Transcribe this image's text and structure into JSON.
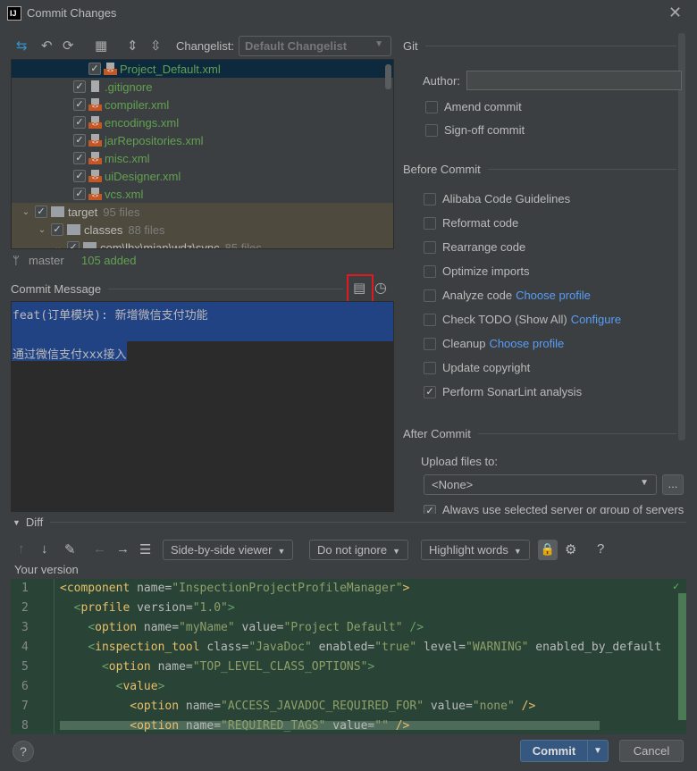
{
  "window": {
    "title": "Commit Changes",
    "logo": "IJ"
  },
  "toolbar": {
    "changelist_label": "Changelist:",
    "changelist_value": "Default Changelist"
  },
  "tree": [
    {
      "name": "Project_Default.xml",
      "type": "xml",
      "selected": true
    },
    {
      "name": ".gitignore",
      "type": "ignore"
    },
    {
      "name": "compiler.xml",
      "type": "xml"
    },
    {
      "name": "encodings.xml",
      "type": "xml"
    },
    {
      "name": "jarRepositories.xml",
      "type": "xml"
    },
    {
      "name": "misc.xml",
      "type": "xml"
    },
    {
      "name": "uiDesigner.xml",
      "type": "xml"
    },
    {
      "name": "vcs.xml",
      "type": "xml"
    },
    {
      "name": "target",
      "count": "95 files",
      "type": "dir"
    },
    {
      "name": "classes",
      "count": "88 files",
      "type": "dir"
    },
    {
      "name": "com\\lbx\\mian\\wdz\\sync",
      "count": "85 files",
      "type": "dir"
    }
  ],
  "status": {
    "branch": "master",
    "added": "105 added"
  },
  "commit_message": {
    "label": "Commit Message",
    "line1": "feat(订单模块): 新增微信支付功能",
    "line3": "通过微信支付xxx接入"
  },
  "git": {
    "section": "Git",
    "author_label": "Author:",
    "author_value": "",
    "amend": "Amend commit",
    "signoff": "Sign-off commit"
  },
  "before_commit": {
    "section": "Before Commit",
    "items": [
      {
        "label": "Alibaba Code Guidelines",
        "checked": false
      },
      {
        "label": "Reformat code",
        "checked": false
      },
      {
        "label": "Rearrange code",
        "checked": false
      },
      {
        "label": "Optimize imports",
        "checked": false
      },
      {
        "label": "Analyze code",
        "link": "Choose profile",
        "checked": false
      },
      {
        "label": "Check TODO (Show All)",
        "link": "Configure",
        "checked": false
      },
      {
        "label": "Cleanup",
        "link": "Choose profile",
        "checked": false
      },
      {
        "label": "Update copyright",
        "checked": false
      },
      {
        "label": "Perform SonarLint analysis",
        "checked": true
      }
    ]
  },
  "after_commit": {
    "section": "After Commit",
    "upload_label": "Upload files to:",
    "upload_value": "<None>",
    "dots": "...",
    "always": "Always use selected server or group of servers"
  },
  "diff": {
    "section": "Diff",
    "viewer": "Side-by-side viewer",
    "ignore": "Do not ignore",
    "highlight": "Highlight words",
    "help": "?",
    "your_version": "Your version",
    "lines": [
      {
        "n": "1",
        "html": "<span class='t'>&lt;component</span> name=<span class='v'>\"InspectionProjectProfileManager\"</span><span class='t'>&gt;</span>"
      },
      {
        "n": "2",
        "html": "  <span class='p'>&lt;</span><span class='t'>profile</span> version=<span class='v'>\"1.0\"</span><span class='p'>&gt;</span>"
      },
      {
        "n": "3",
        "html": "    <span class='p'>&lt;</span><span class='t'>option</span> name=<span class='v'>\"myName\"</span> value=<span class='v'>\"Project Default\"</span> <span class='p'>/&gt;</span>"
      },
      {
        "n": "4",
        "html": "    <span class='p'>&lt;</span><span class='t'>inspection_tool</span> class=<span class='v'>\"JavaDoc\"</span> enabled=<span class='v'>\"true\"</span> level=<span class='v'>\"WARNING\"</span> enabled_by_default"
      },
      {
        "n": "5",
        "html": "      <span class='p'>&lt;</span><span class='t'>option</span> name=<span class='v'>\"TOP_LEVEL_CLASS_OPTIONS\"</span><span class='p'>&gt;</span>"
      },
      {
        "n": "6",
        "html": "        <span class='p'>&lt;</span><span class='t'>value</span><span class='p'>&gt;</span>"
      },
      {
        "n": "7",
        "html": "          <span class='t'>&lt;option</span> name=<span class='v'>\"ACCESS_JAVADOC_REQUIRED_FOR\"</span> value=<span class='v'>\"none\"</span> <span class='t'>/&gt;</span>"
      },
      {
        "n": "8",
        "html": "          <span class='t'>&lt;option</span> name=<span class='v'>\"REQUIRED_TAGS\"</span> value=<span class='v'>\"\"</span> <span class='t'>/&gt;</span>"
      }
    ]
  },
  "buttons": {
    "commit": "Commit",
    "cancel": "Cancel",
    "help": "?"
  }
}
